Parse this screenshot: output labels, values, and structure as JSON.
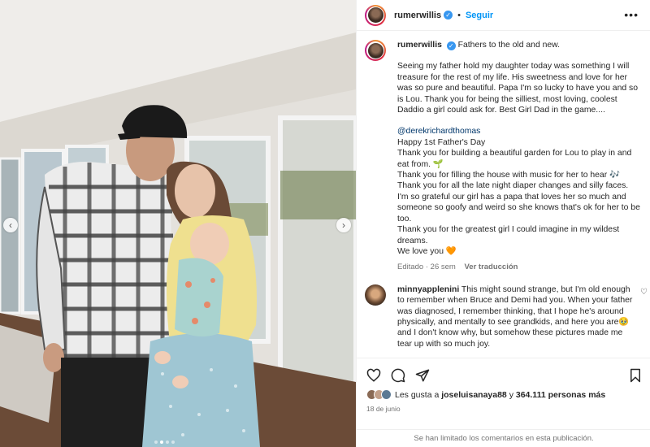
{
  "post": {
    "username": "rumerwillis",
    "follow_label": "Seguir",
    "separator": "•",
    "more_icon": "more-options-icon"
  },
  "caption": {
    "username": "rumerwillis",
    "first_line": "Fathers to the old and new.",
    "para1": "Seeing my father hold my daughter today was something I will treasure for the rest of my life. His sweetness and love for her was so pure and beautiful. Papa I'm so lucky to have you and so is Lou. Thank you for being the silliest, most loving, coolest Daddio a girl could ask for. Best Girl Dad in the game....",
    "mention": "@derekrichardthomas",
    "line_happy": "Happy 1st Father's Day",
    "line_garden": "Thank you for building a beautiful garden for Lou to play in and eat from. 🌱",
    "line_music": "Thank you for filling the house with music for her to hear 🎶",
    "line_diaper": "Thank you for all the late night diaper changes and silly faces. I'm so grateful our girl has a papa that loves her so much and someone so goofy and weird so she knows that's ok for her to be too.",
    "line_greatest": "Thank you for the greatest girl I could imagine in my wildest dreams.",
    "line_love": "We love you 🧡",
    "meta_time": "Editado · 26 sem",
    "meta_translate": "Ver traducción"
  },
  "comment": {
    "username": "minnyapplenini",
    "text": "This might sound strange, but I'm old enough to remember when Bruce and Demi had you. When your father was diagnosed, I remember thinking, that I hope he's around physically, and mentally to see grandkids, and here you are🥹 and I don't know why, but somehow these pictures made me tear up with so much joy.",
    "like_icon": "heart-outline-icon"
  },
  "actions": {
    "likes_prefix": "Les gusta a",
    "likes_user": "joseluisanaya88",
    "likes_mid": "y",
    "likes_count": "364.111 personas más",
    "date": "18 de junio",
    "limited_notice": "Se han limitado los comentarios en esta publicación."
  },
  "carousel": {
    "slides": 4,
    "active": 1
  },
  "colors": {
    "link": "#0095f6",
    "mention": "#00376b",
    "meta": "#737373",
    "verified": "#3897f0"
  }
}
